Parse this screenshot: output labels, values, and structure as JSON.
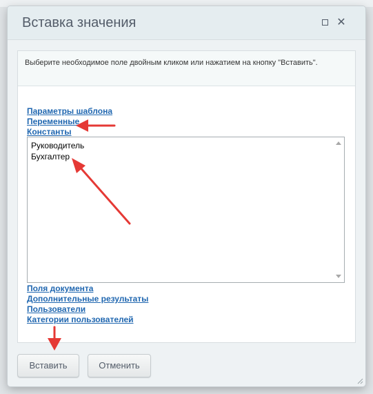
{
  "dialog": {
    "title": "Вставка значения",
    "hint": "Выберите необходимое поле двойным кликом или нажатием на кнопку \"Вставить\".",
    "sections": [
      "Параметры шаблона",
      "Переменные",
      "Константы"
    ],
    "list_items": [
      "Руководитель",
      "Бухгалтер"
    ],
    "sections_after": [
      "Поля документа",
      "Дополнительные результаты",
      "Пользователи",
      "Категории пользователей"
    ],
    "buttons": {
      "insert": "Вставить",
      "cancel": "Отменить"
    }
  },
  "colors": {
    "link": "#2067b0",
    "annotation_arrow": "#e53935",
    "title": "#535c69"
  },
  "icons": {
    "maximize": "maximize-icon",
    "close": "close-icon",
    "resize": "resize-grip-icon"
  }
}
